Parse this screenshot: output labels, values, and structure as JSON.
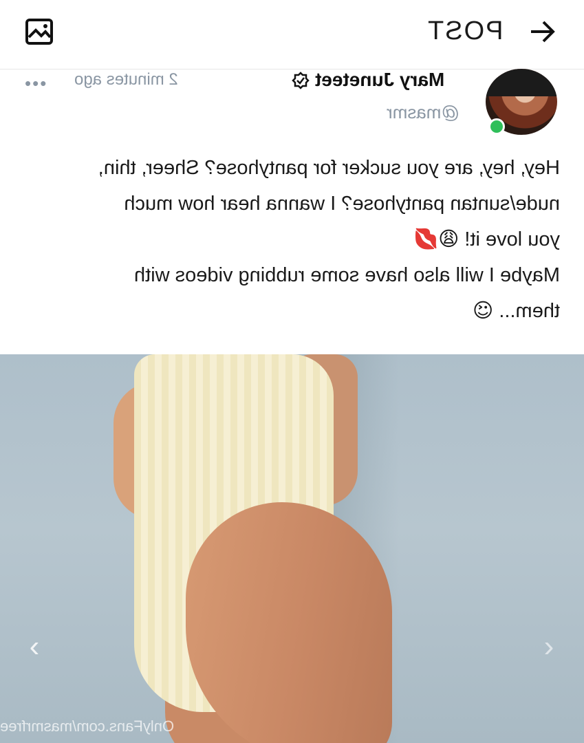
{
  "header": {
    "title": "POST",
    "back_icon": "arrow-right-icon",
    "media_icon": "image-icon"
  },
  "author": {
    "name": "Mary Juneteet",
    "handle": "@masmr",
    "time": "2 minutes ago",
    "menu": "•••",
    "online_color": "#2fbf5a"
  },
  "post": {
    "line1": "Hey, hey, are you sucker for pantyhose? Sheer, thin,",
    "line2": "nude/suntan pantyhose? I wanna hear how much",
    "line3": "you love it! 😩💋",
    "line4": "Maybe I will also have some rubbing videos with",
    "line5": "them... 😉"
  },
  "media": {
    "prev": "‹",
    "next": "›",
    "watermark": "OnlyFans.com/masmrfree"
  },
  "colors": {
    "muted": "#8a96a3",
    "background": "#ffffff"
  }
}
